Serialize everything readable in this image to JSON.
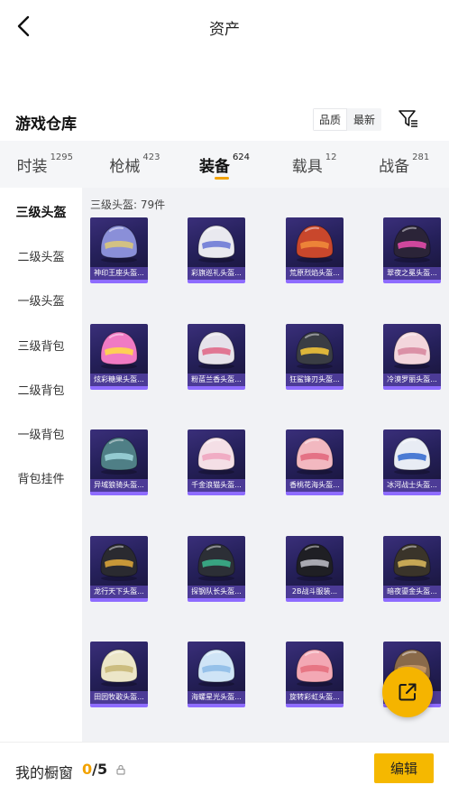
{
  "header": {
    "title": "资产",
    "back_icon": "chevron-left-icon"
  },
  "warehouse": {
    "title": "游戏仓库",
    "sort_options": [
      "品质",
      "最新"
    ],
    "active_sort": "品质",
    "filter_icon": "filter-icon"
  },
  "tabs": [
    {
      "label": "时装",
      "count": "1295"
    },
    {
      "label": "枪械",
      "count": "423"
    },
    {
      "label": "装备",
      "count": "624",
      "active": true
    },
    {
      "label": "载具",
      "count": "12"
    },
    {
      "label": "战备",
      "count": "281"
    }
  ],
  "sidebar": {
    "items": [
      {
        "label": "三级头盔",
        "active": true
      },
      {
        "label": "二级头盔"
      },
      {
        "label": "一级头盔"
      },
      {
        "label": "三级背包"
      },
      {
        "label": "二级背包"
      },
      {
        "label": "一级背包"
      },
      {
        "label": "背包挂件"
      }
    ]
  },
  "content": {
    "count_text": "三级头盔: 79件",
    "items": [
      {
        "name": "神印王座头盔...",
        "color": "#8a8fd8",
        "accent": "#d9c67a"
      },
      {
        "name": "彩旗巡礼头盔...",
        "color": "#e9e9ef",
        "accent": "#6e7bd6"
      },
      {
        "name": "荒原烈焰头盔...",
        "color": "#c9472c",
        "accent": "#f08a3a"
      },
      {
        "name": "翠夜之冕头盔...",
        "color": "#2b2438",
        "accent": "#e04ba8"
      },
      {
        "name": "炫彩糖果头盔...",
        "color": "#f07ac4",
        "accent": "#ffd84a"
      },
      {
        "name": "粉蓝兰香头盔...",
        "color": "#e6e2ea",
        "accent": "#e06a8a"
      },
      {
        "name": "狂鲨锋刃头盔...",
        "color": "#3a3d44",
        "accent": "#f0c23a"
      },
      {
        "name": "冷漠罗丽头盔...",
        "color": "#f3d6dc",
        "accent": "#d88aa0"
      },
      {
        "name": "异域狼骑头盔...",
        "color": "#4f7f86",
        "accent": "#9ad3d8"
      },
      {
        "name": "千金浪猫头盔...",
        "color": "#f4dfe6",
        "accent": "#f0a6c0"
      },
      {
        "name": "香桃花海头盔...",
        "color": "#f2b8c0",
        "accent": "#e26a7e"
      },
      {
        "name": "冰河战士头盔...",
        "color": "#e8ecf4",
        "accent": "#3a6fd0"
      },
      {
        "name": "龙行天下头盔...",
        "color": "#2a2a30",
        "accent": "#d8a33a"
      },
      {
        "name": "探钢队长头盔...",
        "color": "#2c2f36",
        "accent": "#3ab08a"
      },
      {
        "name": "2B战斗服装...",
        "color": "#1f1f24",
        "accent": "#b8b8c2"
      },
      {
        "name": "暗夜鎏金头盔...",
        "color": "#3a342a",
        "accent": "#d6b45a"
      },
      {
        "name": "田园牧歌头盔...",
        "color": "#ece6c8",
        "accent": "#c9b878"
      },
      {
        "name": "海螺星光头盔...",
        "color": "#cfe4f6",
        "accent": "#8fbce8"
      },
      {
        "name": "旋转彩虹头盔...",
        "color": "#f3a8b4",
        "accent": "#e6707e"
      },
      {
        "name": "",
        "color": "#8a6a4a",
        "accent": "#c89a6a"
      }
    ]
  },
  "bottom_bar": {
    "label": "我的橱窗",
    "used": "0",
    "separator": "/",
    "total": "5",
    "lock_icon": "lock-icon",
    "edit_label": "编辑"
  },
  "fab": {
    "icon": "external-link-icon"
  },
  "colors": {
    "accent": "#f5b400",
    "rarity_bg": "#4c3b96",
    "rarity_bar": "#8e6cff"
  }
}
